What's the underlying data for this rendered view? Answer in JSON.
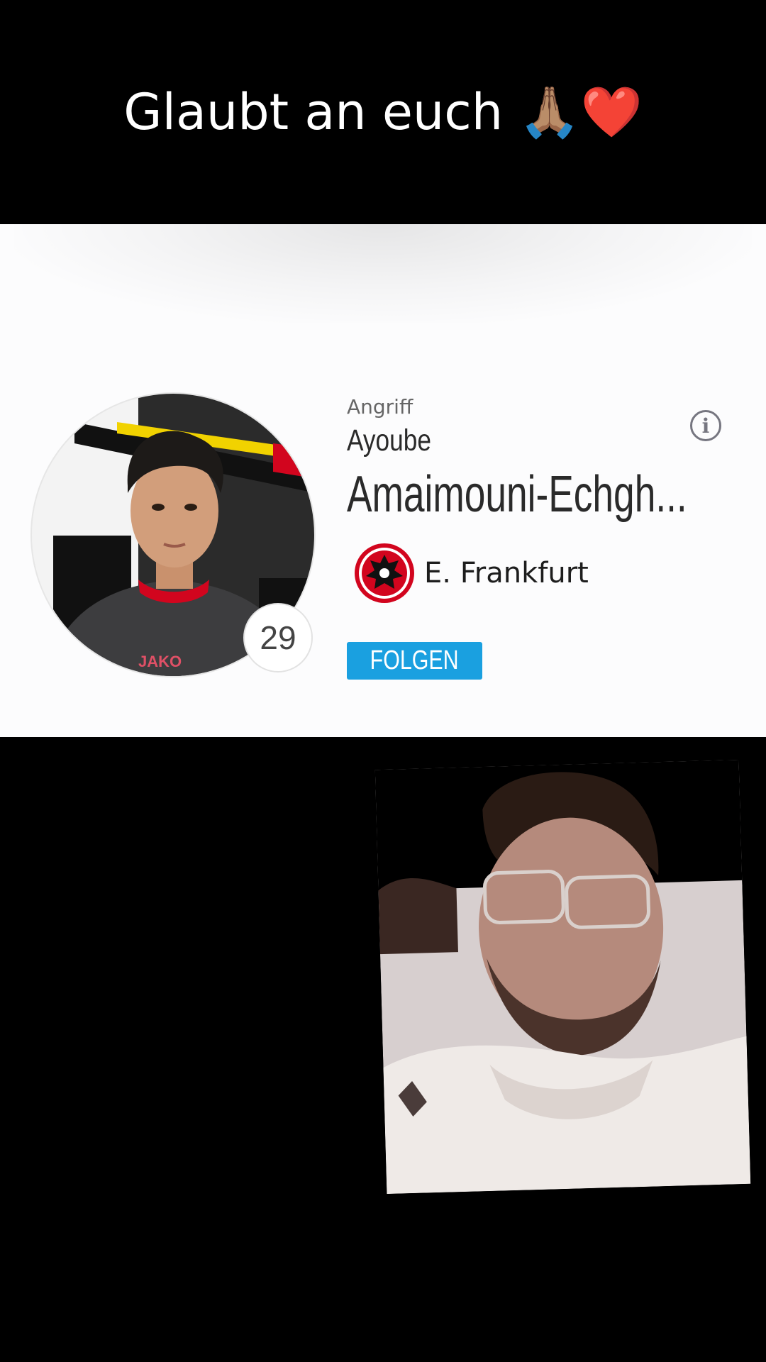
{
  "caption": {
    "text": "Glaubt an euch 🙏🏽❤️"
  },
  "player": {
    "position": "Angriff",
    "first_name": "Ayoube",
    "last_name": "Amaimouni-Echgh...",
    "number": "29",
    "club": "E. Frankfurt",
    "follow_label": "FOLGEN",
    "info_icon": "info-icon"
  },
  "colors": {
    "accent": "#1aa0e0",
    "card_bg": "#fcfcfd",
    "club_red": "#d2051e"
  }
}
